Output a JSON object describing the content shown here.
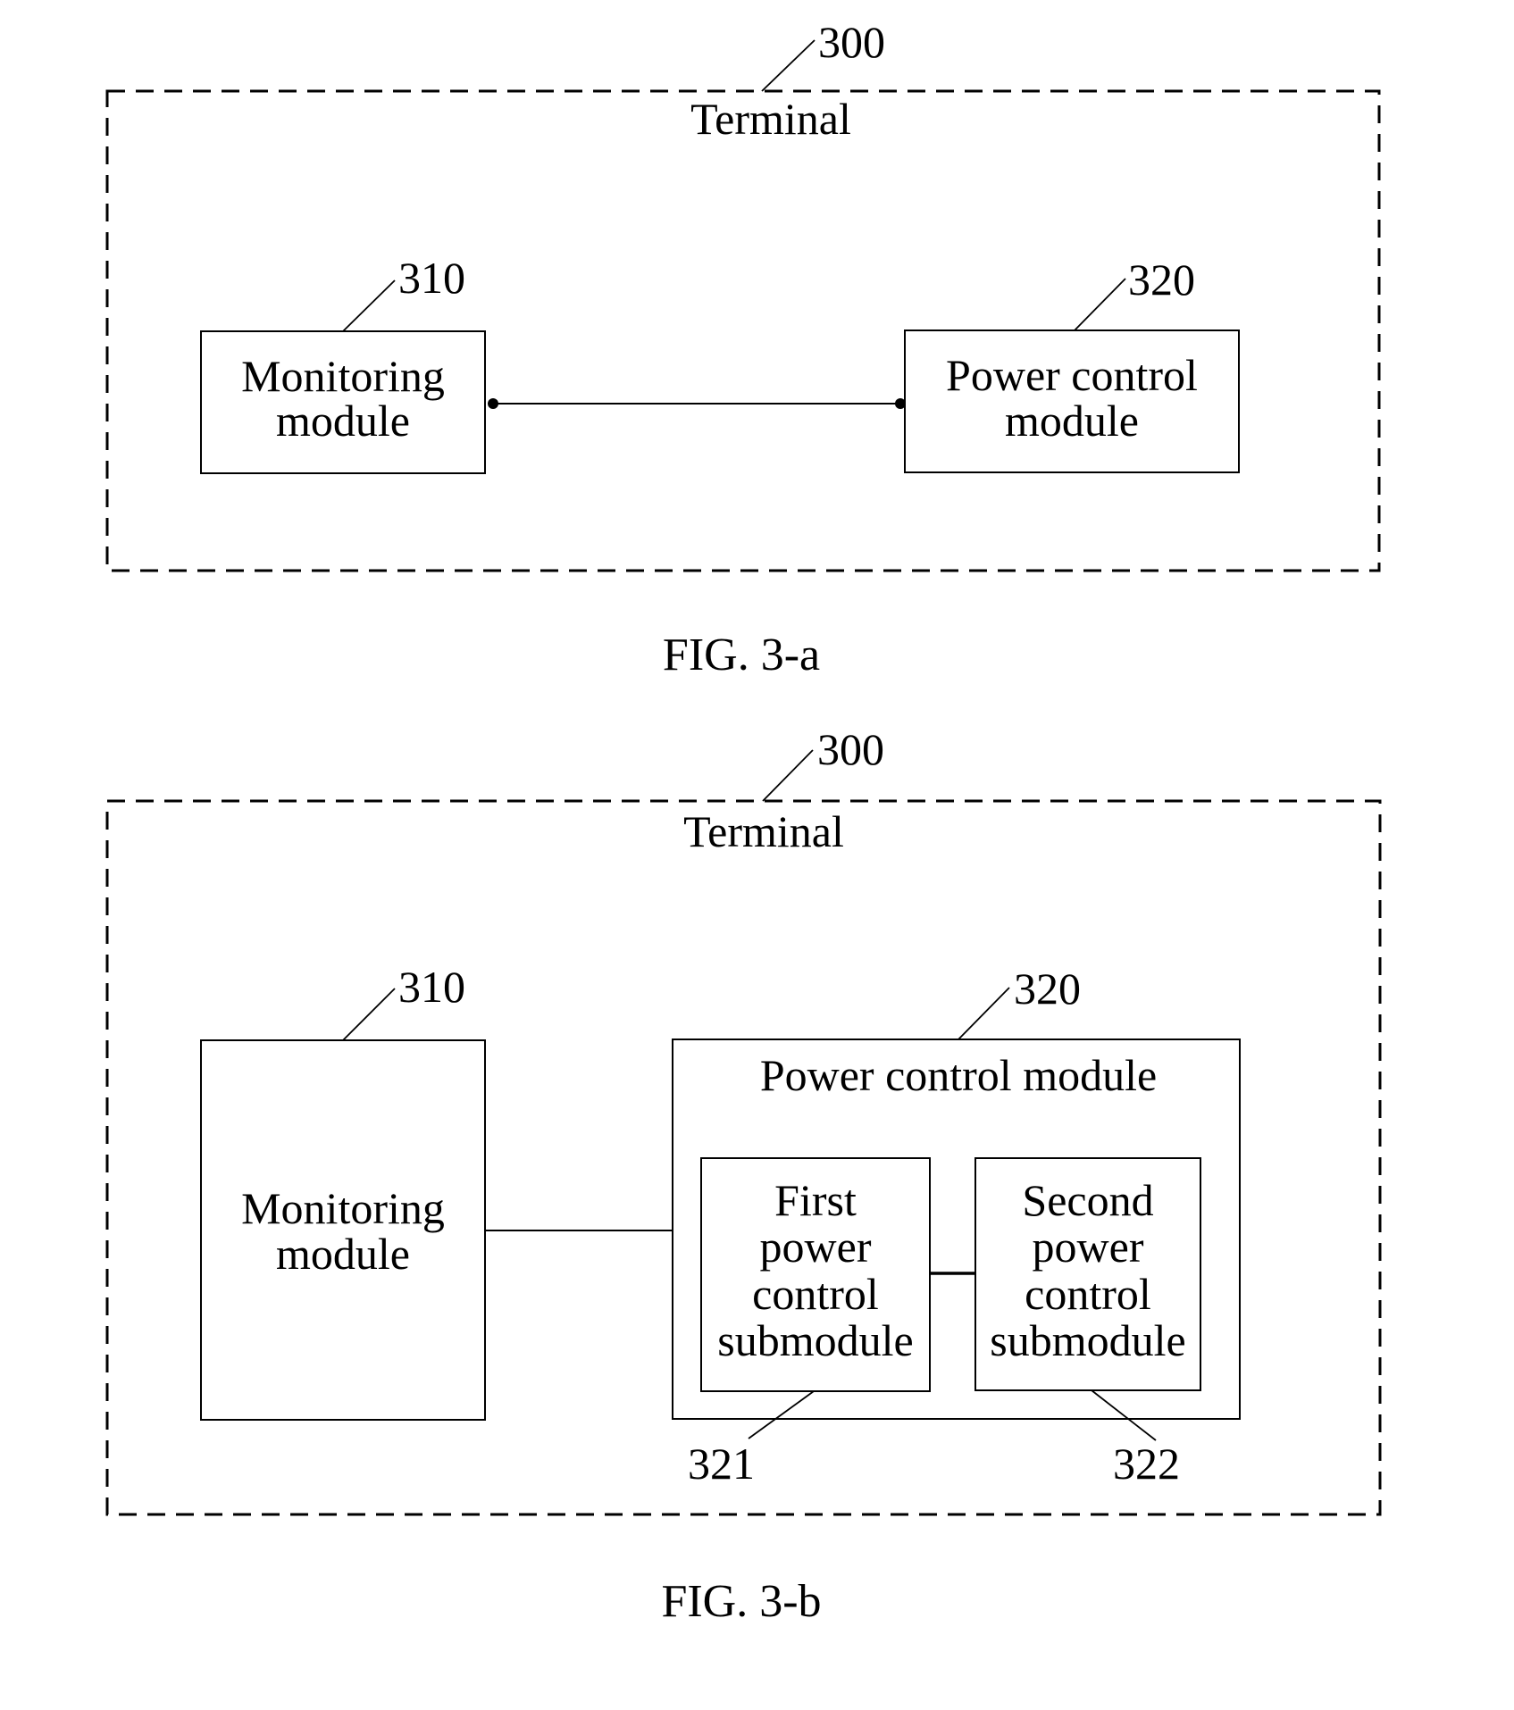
{
  "figures": [
    {
      "caption": "FIG. 3-a",
      "container": {
        "label": "Terminal",
        "ref": "300"
      },
      "modules": [
        {
          "ref": "310",
          "lines": [
            "Monitoring",
            "module"
          ]
        },
        {
          "ref": "320",
          "lines": [
            "Power control",
            "module"
          ]
        }
      ],
      "connections": [
        {
          "from": "310",
          "to": "320",
          "style": "dot-terminated line"
        }
      ]
    },
    {
      "caption": "FIG. 3-b",
      "container": {
        "label": "Terminal",
        "ref": "300"
      },
      "modules": [
        {
          "ref": "310",
          "lines": [
            "Monitoring",
            "module"
          ]
        },
        {
          "ref": "320",
          "title": "Power control module",
          "submodules": [
            {
              "ref": "321",
              "lines": [
                "First",
                "power",
                "control",
                "submodule"
              ]
            },
            {
              "ref": "322",
              "lines": [
                "Second",
                "power",
                "control",
                "submodule"
              ]
            }
          ]
        }
      ],
      "connections": [
        {
          "from": "310",
          "to": "320",
          "style": "line"
        },
        {
          "from": "321",
          "to": "322",
          "style": "line"
        }
      ]
    }
  ]
}
